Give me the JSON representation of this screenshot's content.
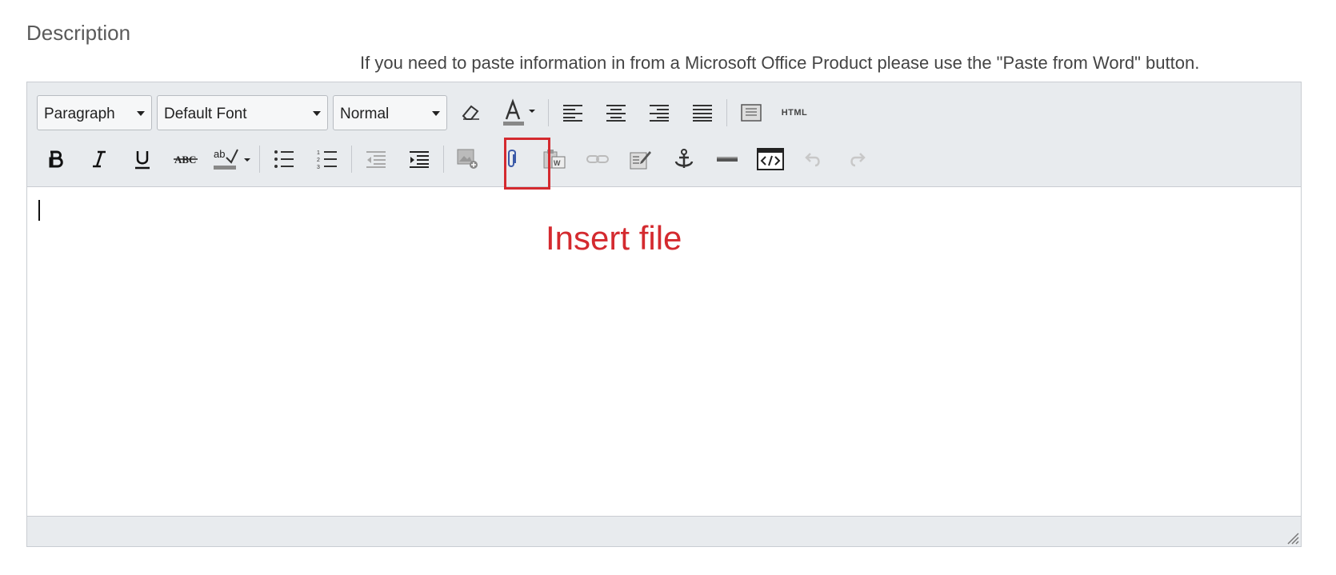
{
  "field": {
    "label": "Description",
    "hint": "If you need to paste information in from a Microsoft Office Product please use the \"Paste from Word\" button."
  },
  "toolbar": {
    "block_format": "Paragraph",
    "font_family": "Default Font",
    "font_size": "Normal",
    "html_button_label": "HTML"
  },
  "annotation": {
    "text": "Insert file",
    "color": "#d42a2f"
  }
}
